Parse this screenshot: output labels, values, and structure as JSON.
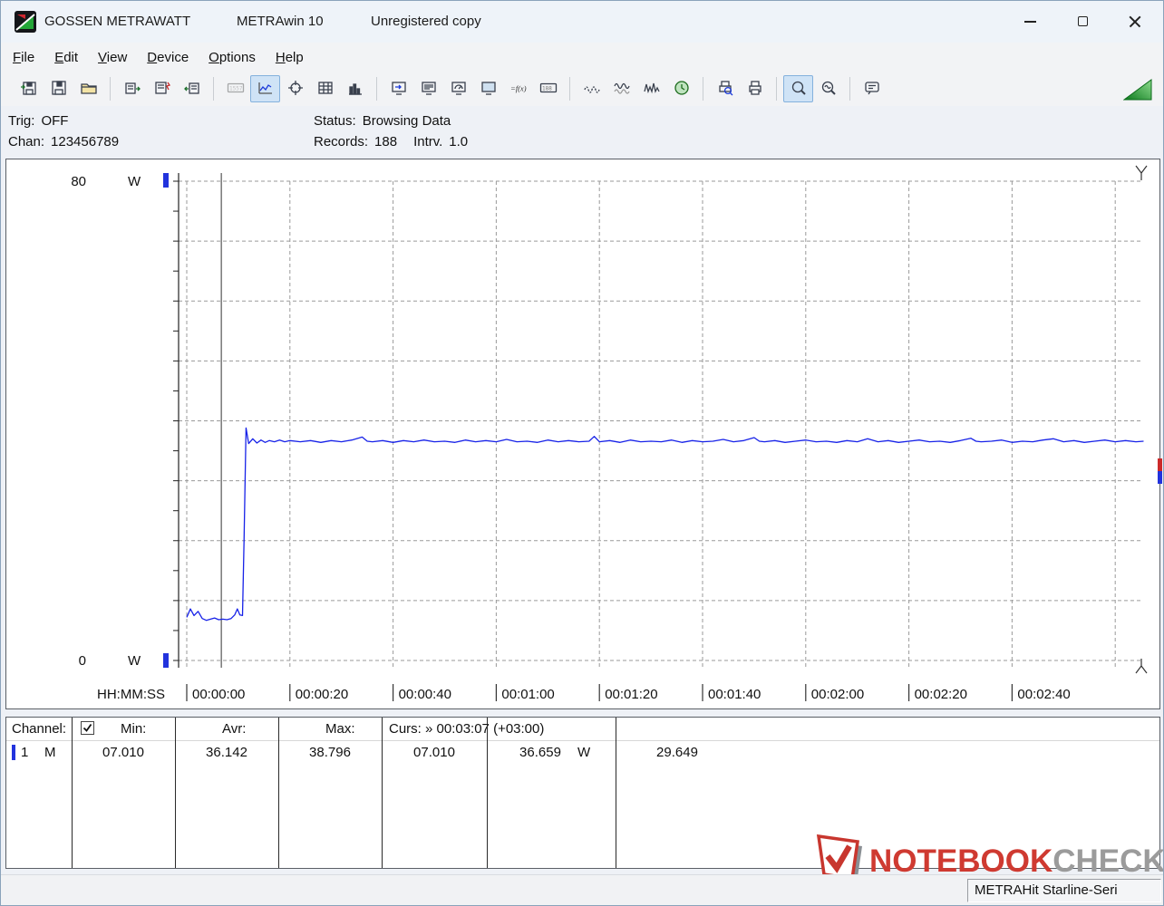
{
  "window": {
    "app_title": "GOSSEN METRAWATT",
    "doc_title": "METRAwin 10",
    "license_note": "Unregistered copy"
  },
  "menu": {
    "items": [
      {
        "label": "File"
      },
      {
        "label": "Edit"
      },
      {
        "label": "View"
      },
      {
        "label": "Device"
      },
      {
        "label": "Options"
      },
      {
        "label": "Help"
      }
    ]
  },
  "toolbar": {
    "groups": [
      [
        {
          "name": "open-data",
          "kind": "floppy-in",
          "state": "normal"
        },
        {
          "name": "save-data",
          "kind": "floppy",
          "state": "normal"
        },
        {
          "name": "open-file",
          "kind": "folder",
          "state": "normal"
        }
      ],
      [
        {
          "name": "device-read",
          "kind": "card-out",
          "state": "normal"
        },
        {
          "name": "device-flash",
          "kind": "card-flash",
          "state": "normal"
        },
        {
          "name": "device-write",
          "kind": "card-in",
          "state": "normal"
        }
      ],
      [
        {
          "name": "display-1557",
          "kind": "display",
          "state": "disabled",
          "icon_text": "1557"
        },
        {
          "name": "view-chart",
          "kind": "chart",
          "state": "active"
        },
        {
          "name": "view-xy",
          "kind": "crosshair",
          "state": "normal"
        },
        {
          "name": "view-table",
          "kind": "grid",
          "state": "normal"
        },
        {
          "name": "view-histogram",
          "kind": "histogram",
          "state": "normal"
        }
      ],
      [
        {
          "name": "transfer-window",
          "kind": "monitor-arrow",
          "state": "normal"
        },
        {
          "name": "list-window",
          "kind": "monitor-list",
          "state": "normal"
        },
        {
          "name": "meter-window",
          "kind": "monitor-meter",
          "state": "normal"
        },
        {
          "name": "screen-window",
          "kind": "monitor-screen",
          "state": "normal"
        },
        {
          "name": "formula",
          "kind": "formula",
          "state": "normal",
          "icon_text": "=f(x)"
        },
        {
          "name": "digital-display",
          "kind": "display",
          "state": "normal",
          "icon_text": "188"
        }
      ],
      [
        {
          "name": "curve-min",
          "kind": "wave-dash",
          "state": "normal"
        },
        {
          "name": "curve-envelope",
          "kind": "wave-dual",
          "state": "normal"
        },
        {
          "name": "curve-spikes",
          "kind": "wave-spike",
          "state": "normal"
        },
        {
          "name": "timer",
          "kind": "clock",
          "state": "normal"
        }
      ],
      [
        {
          "name": "print-preview",
          "kind": "print-preview",
          "state": "normal"
        },
        {
          "name": "print",
          "kind": "print",
          "state": "normal"
        }
      ],
      [
        {
          "name": "zoom-mode",
          "kind": "zoom",
          "state": "active"
        },
        {
          "name": "zoom-curve",
          "kind": "zoom-wave",
          "state": "normal"
        }
      ],
      [
        {
          "name": "annotation",
          "kind": "note",
          "state": "normal"
        }
      ]
    ]
  },
  "status_info": {
    "trig_label": "Trig:",
    "trig_value": "OFF",
    "chan_label": "Chan:",
    "chan_value": "123456789",
    "status_label": "Status:",
    "status_value": "Browsing Data",
    "records_label": "Records:",
    "records_value": "188",
    "interval_label": "Intrv.",
    "interval_value": "1.0"
  },
  "chart_data": {
    "type": "line",
    "y_axis": {
      "max_label": "80",
      "min_label": "0",
      "unit": "W",
      "ylim": [
        0,
        80
      ],
      "grid_step_w": 10
    },
    "x_axis": {
      "label": "HH:MM:SS",
      "tick_interval_s": 20,
      "ticks": [
        "00:00:00",
        "00:00:20",
        "00:00:40",
        "00:01:00",
        "00:01:20",
        "00:01:40",
        "00:02:00",
        "00:02:20",
        "00:02:40"
      ],
      "xlim_s": [
        0,
        186
      ]
    },
    "cursors": {
      "cursor1_time_s": 6.7,
      "cursor2_time_s": 185.6,
      "cursor2_label": "00:03:07 (+03:00)"
    },
    "grid": true,
    "legend": "none",
    "series": [
      {
        "name": "channel-1-power-w",
        "color": "#1722e8",
        "points": [
          [
            0,
            7.2
          ],
          [
            0.7,
            8.6
          ],
          [
            1.4,
            7.5
          ],
          [
            2.2,
            8.2
          ],
          [
            3,
            7.0
          ],
          [
            3.8,
            6.7
          ],
          [
            4.6,
            6.9
          ],
          [
            5.4,
            7.1
          ],
          [
            6.2,
            6.8
          ],
          [
            7,
            6.9
          ],
          [
            7.8,
            6.8
          ],
          [
            8.6,
            7.0
          ],
          [
            9.3,
            7.6
          ],
          [
            9.8,
            8.6
          ],
          [
            10.3,
            7.6
          ],
          [
            10.8,
            7.5
          ],
          [
            11.1,
            20.0
          ],
          [
            11.5,
            38.8
          ],
          [
            12,
            36.2
          ],
          [
            12.8,
            37.0
          ],
          [
            13.6,
            36.3
          ],
          [
            14.4,
            36.8
          ],
          [
            15.2,
            36.4
          ],
          [
            16,
            36.7
          ],
          [
            17,
            36.5
          ],
          [
            18,
            36.8
          ],
          [
            19,
            36.5
          ],
          [
            20,
            36.7
          ],
          [
            22,
            36.5
          ],
          [
            24,
            36.7
          ],
          [
            26,
            36.4
          ],
          [
            28,
            36.7
          ],
          [
            30,
            36.5
          ],
          [
            32,
            36.8
          ],
          [
            34,
            37.3
          ],
          [
            35,
            36.6
          ],
          [
            36,
            36.5
          ],
          [
            38,
            36.7
          ],
          [
            40,
            36.4
          ],
          [
            42,
            36.7
          ],
          [
            44,
            36.5
          ],
          [
            46,
            36.8
          ],
          [
            48,
            36.5
          ],
          [
            50,
            36.6
          ],
          [
            52,
            36.4
          ],
          [
            54,
            36.8
          ],
          [
            56,
            36.5
          ],
          [
            58,
            36.7
          ],
          [
            60,
            36.5
          ],
          [
            62,
            36.9
          ],
          [
            64,
            36.5
          ],
          [
            66,
            36.6
          ],
          [
            68,
            36.4
          ],
          [
            70,
            36.8
          ],
          [
            72,
            36.5
          ],
          [
            74,
            36.7
          ],
          [
            76,
            36.5
          ],
          [
            78,
            36.6
          ],
          [
            79,
            37.4
          ],
          [
            80,
            36.5
          ],
          [
            82,
            36.7
          ],
          [
            84,
            36.4
          ],
          [
            86,
            36.8
          ],
          [
            88,
            36.5
          ],
          [
            90,
            36.6
          ],
          [
            92,
            36.5
          ],
          [
            94,
            36.8
          ],
          [
            96,
            36.4
          ],
          [
            98,
            36.7
          ],
          [
            100,
            36.5
          ],
          [
            102,
            36.6
          ],
          [
            104,
            36.9
          ],
          [
            106,
            36.5
          ],
          [
            108,
            36.7
          ],
          [
            110,
            37.2
          ],
          [
            111,
            36.6
          ],
          [
            112,
            36.5
          ],
          [
            114,
            36.7
          ],
          [
            116,
            36.4
          ],
          [
            118,
            36.6
          ],
          [
            120,
            36.8
          ],
          [
            122,
            36.5
          ],
          [
            124,
            36.6
          ],
          [
            126,
            36.4
          ],
          [
            128,
            36.7
          ],
          [
            130,
            36.5
          ],
          [
            132,
            37.0
          ],
          [
            134,
            36.5
          ],
          [
            136,
            36.7
          ],
          [
            138,
            36.4
          ],
          [
            140,
            36.6
          ],
          [
            142,
            36.8
          ],
          [
            144,
            36.5
          ],
          [
            146,
            36.6
          ],
          [
            148,
            36.4
          ],
          [
            150,
            36.7
          ],
          [
            152,
            37.1
          ],
          [
            153,
            36.6
          ],
          [
            154,
            36.5
          ],
          [
            156,
            36.6
          ],
          [
            158,
            36.8
          ],
          [
            160,
            36.4
          ],
          [
            162,
            36.6
          ],
          [
            164,
            36.5
          ],
          [
            166,
            36.8
          ],
          [
            168,
            37.0
          ],
          [
            170,
            36.5
          ],
          [
            172,
            36.7
          ],
          [
            174,
            36.4
          ],
          [
            176,
            36.6
          ],
          [
            178,
            36.8
          ],
          [
            180,
            36.5
          ],
          [
            182,
            36.7
          ],
          [
            184,
            36.5
          ],
          [
            185.5,
            36.6
          ]
        ]
      }
    ]
  },
  "table": {
    "header": {
      "channel": "Channel:",
      "min": "Min:",
      "avr": "Avr:",
      "max": "Max:",
      "curs": "Curs: » 00:03:07 (+03:00)",
      "visibility_checked": true
    },
    "rows": [
      {
        "channel": "1",
        "mode": "M",
        "min": "07.010",
        "avr": "36.142",
        "max": "38.796",
        "curs1": "07.010",
        "curs2": "36.659",
        "curs2_unit": "W",
        "delta": "29.649"
      }
    ]
  },
  "watermark": {
    "brand_primary": "NOTEBOOK",
    "brand_secondary": "CHECK"
  },
  "statusbar": {
    "device_name": "METRAHit Starline-Seri"
  },
  "colors": {
    "trace": "#1722e8",
    "grid": "#9a9a9a",
    "cursor": "#333333",
    "handle_blue": "#2233dd",
    "active_btn_bg": "#cfe3f6",
    "watermark_red": "#cf3a31",
    "watermark_gray": "#9b9b9b",
    "edge_red": "#cc2a2a",
    "edge_blue": "#2233dd",
    "triangle_green": "#1f9d2f"
  }
}
